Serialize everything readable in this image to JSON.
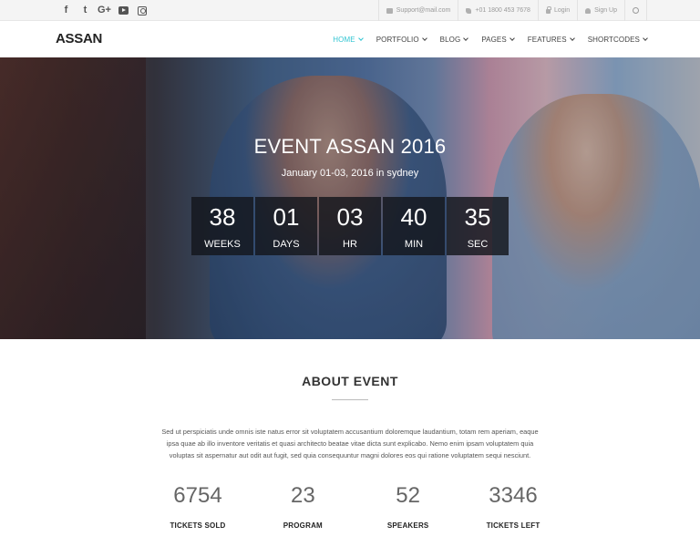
{
  "topbar": {
    "social": [
      {
        "icon": "facebook-icon",
        "glyph": "f"
      },
      {
        "icon": "twitter-icon",
        "glyph": "t"
      },
      {
        "icon": "google-plus-icon",
        "glyph": "G+"
      },
      {
        "icon": "youtube-icon",
        "glyph": ""
      },
      {
        "icon": "instagram-icon",
        "glyph": ""
      }
    ],
    "email": "Support@mail.com",
    "phone": "+01 1800 453 7678",
    "login": "Login",
    "signup": "Sign Up"
  },
  "navbar": {
    "logo": "ASSAN",
    "items": [
      "HOME",
      "PORTFOLIO",
      "BLOG",
      "PAGES",
      "FEATURES",
      "SHORTCODES"
    ],
    "active_color": "#32c5d2"
  },
  "hero": {
    "title": "EVENT ASSAN 2016",
    "subtitle": "January 01-03, 2016 in sydney",
    "countdown": [
      {
        "value": "38",
        "label": "WEEKS"
      },
      {
        "value": "01",
        "label": "DAYS"
      },
      {
        "value": "03",
        "label": "HR"
      },
      {
        "value": "40",
        "label": "MIN"
      },
      {
        "value": "35",
        "label": "SEC"
      }
    ]
  },
  "about": {
    "title": "ABOUT EVENT",
    "text": "Sed ut perspiciatis unde omnis iste natus error sit voluptatem accusantium doloremque laudantium, totam rem aperiam, eaque ipsa quae ab illo inventore veritatis et quasi architecto beatae vitae dicta sunt explicabo. Nemo enim ipsam voluptatem quia voluptas sit aspernatur aut odit aut fugit, sed quia consequuntur magni dolores eos qui ratione voluptatem sequi nesciunt.",
    "stats": [
      {
        "value": "6754",
        "label": "TICKETS SOLD"
      },
      {
        "value": "23",
        "label": "PROGRAM"
      },
      {
        "value": "52",
        "label": "SPEAKERS"
      },
      {
        "value": "3346",
        "label": "TICKETS LEFT"
      }
    ]
  }
}
